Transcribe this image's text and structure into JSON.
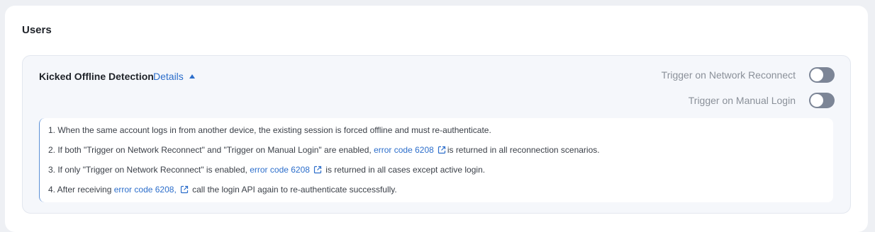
{
  "section": {
    "title": "Users"
  },
  "feature": {
    "title": "Kicked Offline Detection",
    "details_label": "Details",
    "toggles": [
      {
        "label": "Trigger on Network Reconnect",
        "enabled": false
      },
      {
        "label": "Trigger on Manual Login",
        "enabled": false
      }
    ]
  },
  "notes": [
    {
      "before": "1. When the same account logs in from another device, the existing session is forced offline and must re-authenticate."
    },
    {
      "before": "2. If both \"Trigger on Network Reconnect\" and \"Trigger on Manual Login\" are enabled, ",
      "link": "error code 6208",
      "after": "is returned in all reconnection scenarios."
    },
    {
      "before": "3. If only \"Trigger on Network Reconnect\" is enabled, ",
      "link": "error code 6208",
      "after": " is returned in all cases except active login."
    },
    {
      "before": "4. After receiving ",
      "link": "error code 6208,",
      "after": " call the login API again to re-authenticate successfully."
    }
  ],
  "colors": {
    "link": "#2c6ecb",
    "toggle_off": "#7c8596",
    "panel_background": "#f5f7fb",
    "page_background": "#eef0f4"
  },
  "icons": {
    "details_toggle": "caret-up-icon",
    "external_link": "external-link-icon"
  }
}
